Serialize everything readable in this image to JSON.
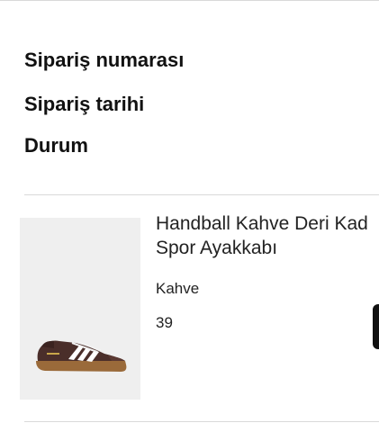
{
  "order_info": {
    "order_number_label": "Sipariş numarası",
    "order_date_label": "Sipariş tarihi",
    "status_label": "Durum"
  },
  "product": {
    "name_line1": "Handball Kahve Deri Kad",
    "name_line2": "Spor Ayakkabı",
    "color": "Kahve",
    "size": "39",
    "image_icon": "brown-sneaker-image"
  },
  "colors": {
    "text": "#111111",
    "divider": "#d9d9d9",
    "image_bg": "#efefef",
    "shoe_upper": "#4a2e2a",
    "shoe_sole": "#9a6a3a",
    "stripes": "#ffffff"
  }
}
